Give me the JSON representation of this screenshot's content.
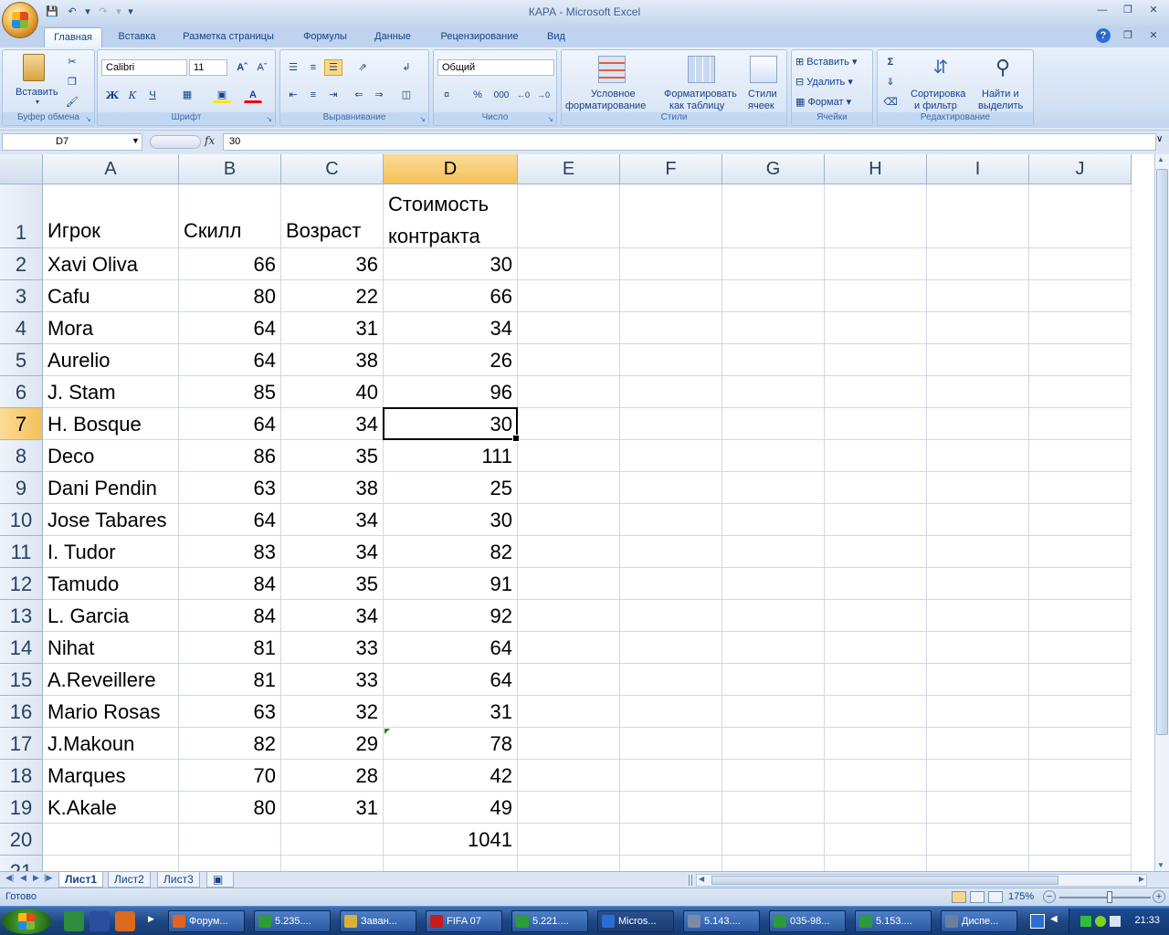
{
  "window": {
    "title": "КАРА - Microsoft Excel"
  },
  "ribbon_tabs": [
    "Главная",
    "Вставка",
    "Разметка страницы",
    "Формулы",
    "Данные",
    "Рецензирование",
    "Вид"
  ],
  "active_tab": "Главная",
  "ribbon": {
    "clipboard": {
      "paste_label": "Вставить",
      "group_label": "Буфер обмена"
    },
    "font": {
      "font_name": "Calibri",
      "font_size": "11",
      "bold": "Ж",
      "italic": "К",
      "underline": "Ч",
      "group_label": "Шрифт"
    },
    "alignment": {
      "group_label": "Выравнивание"
    },
    "number": {
      "format": "Общий",
      "percent": "%",
      "thousands": "000",
      "group_label": "Число"
    },
    "styles": {
      "conditional": "Условное форматирование",
      "conditional_line1": "Условное",
      "conditional_line2": "форматирование",
      "as_table_line1": "Форматировать",
      "as_table_line2": "как таблицу",
      "cell_styles_line1": "Стили",
      "cell_styles_line2": "ячеек",
      "group_label": "Стили"
    },
    "cells": {
      "insert": "Вставить",
      "delete": "Удалить",
      "format": "Формат",
      "group_label": "Ячейки"
    },
    "editing": {
      "sum": "Σ",
      "sort_line1": "Сортировка",
      "sort_line2": "и фильтр",
      "find_line1": "Найти и",
      "find_line2": "выделить",
      "group_label": "Редактирование"
    }
  },
  "formula_bar": {
    "name_box": "D7",
    "fx": "fx",
    "content": "30"
  },
  "columns": [
    "A",
    "B",
    "C",
    "D",
    "E",
    "F",
    "G",
    "H",
    "I",
    "J"
  ],
  "selected_column": "D",
  "selected_row": "7",
  "header_row": {
    "a": "Игрок",
    "b": "Скилл",
    "c": "Возраст",
    "d_line1": "Стоимость",
    "d_line2": "контракта"
  },
  "rows": [
    {
      "n": "2",
      "a": "Xavi Oliva",
      "b": "66",
      "c": "36",
      "d": "30"
    },
    {
      "n": "3",
      "a": "Cafu",
      "b": "80",
      "c": "22",
      "d": "66"
    },
    {
      "n": "4",
      "a": "Mora",
      "b": "64",
      "c": "31",
      "d": "34"
    },
    {
      "n": "5",
      "a": "Aurelio",
      "b": "64",
      "c": "38",
      "d": "26"
    },
    {
      "n": "6",
      "a": "J. Stam",
      "b": "85",
      "c": "40",
      "d": "96"
    },
    {
      "n": "7",
      "a": "H. Bosque",
      "b": "64",
      "c": "34",
      "d": "30"
    },
    {
      "n": "8",
      "a": "Deco",
      "b": "86",
      "c": "35",
      "d": "111"
    },
    {
      "n": "9",
      "a": "Dani Pendin",
      "b": "63",
      "c": "38",
      "d": "25"
    },
    {
      "n": "10",
      "a": "Jose Tabares",
      "b": "64",
      "c": "34",
      "d": "30"
    },
    {
      "n": "11",
      "a": "I. Tudor",
      "b": "83",
      "c": "34",
      "d": "82"
    },
    {
      "n": "12",
      "a": "Tamudo",
      "b": "84",
      "c": "35",
      "d": "91"
    },
    {
      "n": "13",
      "a": "L. Garcia",
      "b": "84",
      "c": "34",
      "d": "92"
    },
    {
      "n": "14",
      "a": "Nihat",
      "b": "81",
      "c": "33",
      "d": "64"
    },
    {
      "n": "15",
      "a": "A.Reveillere",
      "b": "81",
      "c": "33",
      "d": "64"
    },
    {
      "n": "16",
      "a": "Mario Rosas",
      "b": "63",
      "c": "32",
      "d": "31"
    },
    {
      "n": "17",
      "a": "J.Makoun",
      "b": "82",
      "c": "29",
      "d": "78"
    },
    {
      "n": "18",
      "a": "Marques",
      "b": "70",
      "c": "28",
      "d": "42"
    },
    {
      "n": "19",
      "a": "K.Akale",
      "b": "80",
      "c": "31",
      "d": "49"
    },
    {
      "n": "20",
      "a": "",
      "b": "",
      "c": "",
      "d": "1041"
    },
    {
      "n": "21",
      "a": "",
      "b": "",
      "c": "",
      "d": ""
    }
  ],
  "row1_number": "1",
  "sheets": [
    "Лист1",
    "Лист2",
    "Лист3"
  ],
  "active_sheet": "Лист1",
  "status": {
    "text": "Готово",
    "zoom": "175%"
  },
  "taskbar": {
    "buttons": [
      "Форум...",
      "5.235....",
      "Заван...",
      "FIFA 07",
      "5.221....",
      "Micros...",
      "5.143....",
      "035-98...",
      "5.153....",
      "Диспе..."
    ],
    "active": "Micros...",
    "clock": "21:33"
  },
  "colors": {
    "accent": "#15428b",
    "selection_header": "#f4c05a",
    "grid_line": "#d0d7e5"
  }
}
